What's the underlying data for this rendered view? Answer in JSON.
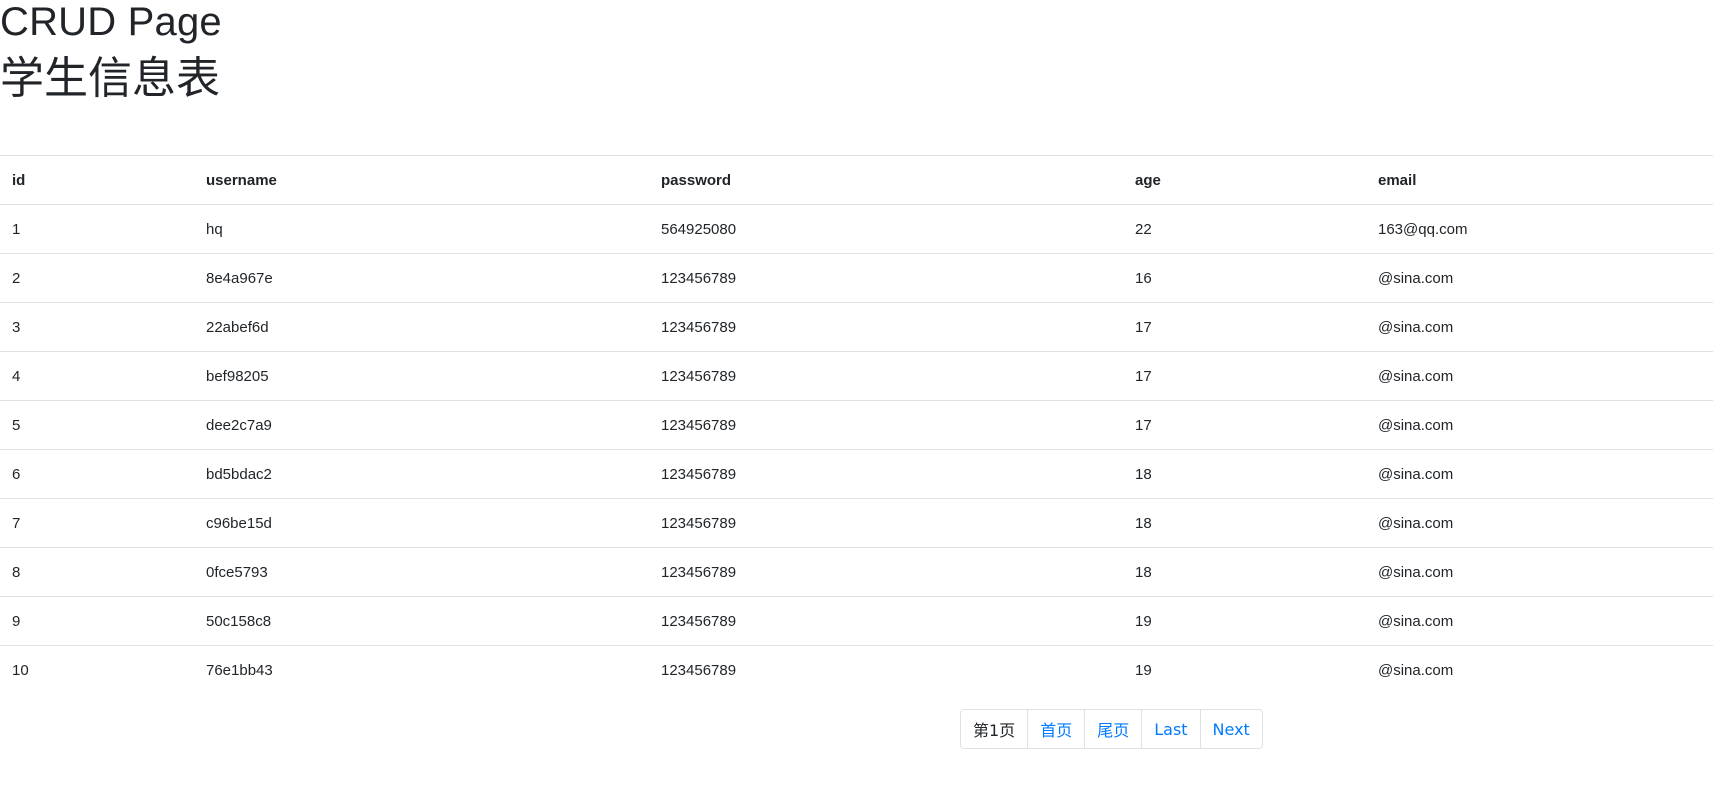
{
  "header": {
    "title": "CRUD Page",
    "subtitle": "学生信息表"
  },
  "table": {
    "columns": [
      "id",
      "username",
      "password",
      "age",
      "email"
    ],
    "rows": [
      [
        "1",
        "hq",
        "564925080",
        "22",
        "163@qq.com"
      ],
      [
        "2",
        "8e4a967e",
        "123456789",
        "16",
        "@sina.com"
      ],
      [
        "3",
        "22abef6d",
        "123456789",
        "17",
        "@sina.com"
      ],
      [
        "4",
        "bef98205",
        "123456789",
        "17",
        "@sina.com"
      ],
      [
        "5",
        "dee2c7a9",
        "123456789",
        "17",
        "@sina.com"
      ],
      [
        "6",
        "bd5bdac2",
        "123456789",
        "18",
        "@sina.com"
      ],
      [
        "7",
        "c96be15d",
        "123456789",
        "18",
        "@sina.com"
      ],
      [
        "8",
        "0fce5793",
        "123456789",
        "18",
        "@sina.com"
      ],
      [
        "9",
        "50c158c8",
        "123456789",
        "19",
        "@sina.com"
      ],
      [
        "10",
        "76e1bb43",
        "123456789",
        "19",
        "@sina.com"
      ]
    ]
  },
  "pagination": {
    "current_label": "第1页",
    "first_label": "首页",
    "last_page_label": "尾页",
    "last_label": "Last",
    "next_label": "Next"
  },
  "colors": {
    "text": "#212529",
    "link": "#007bff",
    "border": "#dee2e6"
  }
}
